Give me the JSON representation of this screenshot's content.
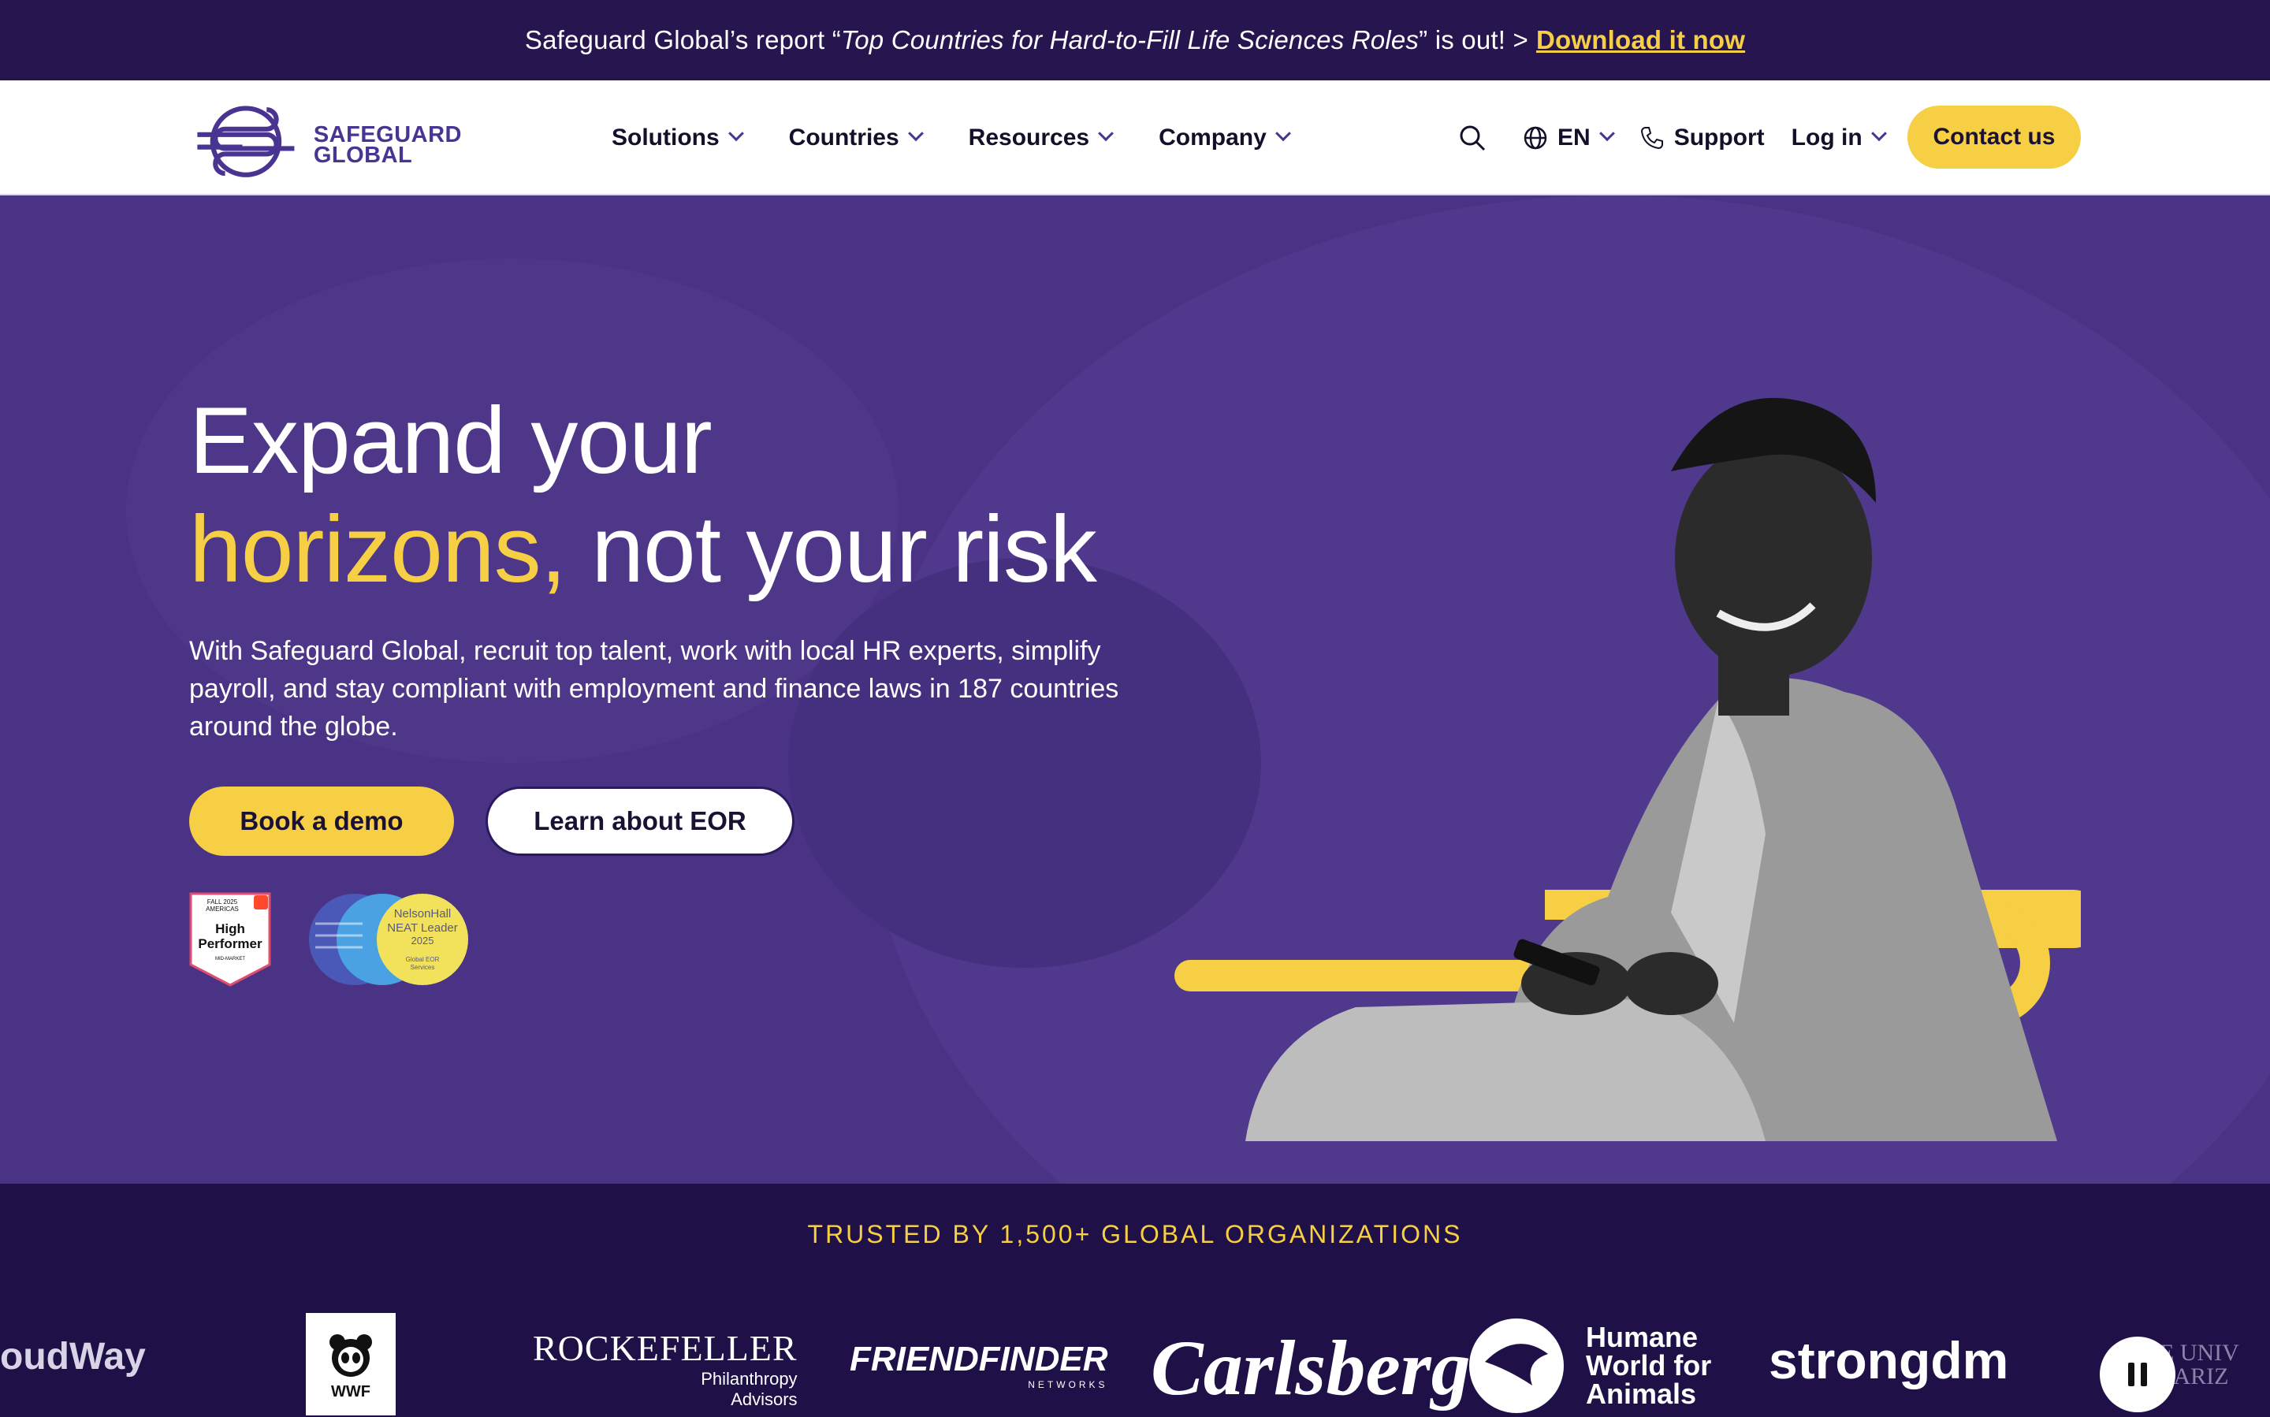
{
  "announcement": {
    "prefix": "Safeguard Global’s report “",
    "report_title": "Top Countries for Hard-to-Fill Life Sciences Roles",
    "suffix": "” is out! >",
    "link_label": "Download it now"
  },
  "header": {
    "logo_line1": "SAFEGUARD",
    "logo_line2": "GLOBAL",
    "nav": [
      {
        "label": "Solutions"
      },
      {
        "label": "Countries"
      },
      {
        "label": "Resources"
      },
      {
        "label": "Company"
      }
    ],
    "language": "EN",
    "support_label": "Support",
    "login_label": "Log in",
    "contact_label": "Contact us"
  },
  "hero": {
    "title_line1": "Expand your",
    "title_accent": "horizons,",
    "title_line2_rest": " not your risk",
    "description": "With Safeguard Global, recruit top talent, work with local HR experts, simplify payroll, and stay compliant with employment and finance laws in 187 countries around the globe.",
    "primary_cta": "Book a demo",
    "secondary_cta": "Learn about EOR",
    "badge_g2": {
      "line1": "FALL 2025",
      "line2": "AMERICAS",
      "title1": "High",
      "title2": "Performer",
      "footer": "MID-MARKET"
    },
    "badge_nelsonhall": {
      "line1": "NelsonHall",
      "line2": "NEAT Leader",
      "line3": "2025",
      "line4": "Global EOR",
      "line5": "Services"
    }
  },
  "trusted": {
    "title": "TRUSTED BY 1,500+ GLOBAL ORGANIZATIONS",
    "logos": [
      {
        "name": "oudWay"
      },
      {
        "name": "WWF"
      },
      {
        "name": "ROCKEFELLER",
        "sub1": "Philanthropy",
        "sub2": "Advisors"
      },
      {
        "name": "FRIENDFINDER",
        "sub1": "NETWORKS"
      },
      {
        "name": "Carlsberg"
      },
      {
        "name": "Humane",
        "sub1": "World for",
        "sub2": "Animals"
      },
      {
        "name": "strongdm"
      },
      {
        "name": "THE UNIV",
        "sub1": "OF ARIZ"
      }
    ]
  },
  "colors": {
    "brand_purple": "#4a3385",
    "dark_purple": "#1f1147",
    "accent_yellow": "#f6cf45",
    "logo_purple": "#4a3491"
  }
}
